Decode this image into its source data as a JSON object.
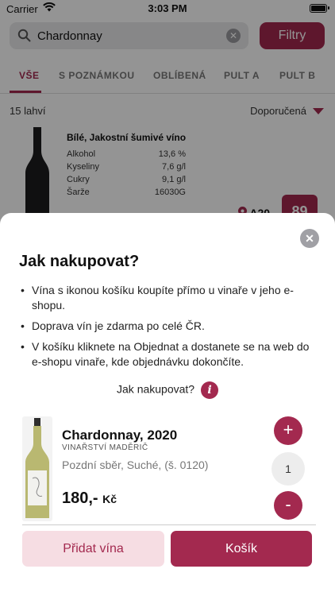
{
  "status": {
    "carrier": "Carrier",
    "time": "3:03 PM"
  },
  "search": {
    "value": "Chardonnay",
    "filter_label": "Filtry"
  },
  "tabs": [
    {
      "label": "VŠE",
      "active": true
    },
    {
      "label": "S POZNÁMKOU",
      "active": false
    },
    {
      "label": "OBLÍBENÁ",
      "active": false
    },
    {
      "label": "PULT A",
      "active": false
    },
    {
      "label": "PULT B",
      "active": false
    }
  ],
  "list": {
    "count": "15 lahví",
    "sort": "Doporučená"
  },
  "card": {
    "title": "Bílé, Jakostní šumivé víno",
    "rows": [
      {
        "label": "Alkohol",
        "value": "13,6 %"
      },
      {
        "label": "Kyseliny",
        "value": "7,6 g/l"
      },
      {
        "label": "Cukry",
        "value": "9,1 g/l"
      },
      {
        "label": "Šarže",
        "value": "16030G"
      }
    ],
    "location": "A20",
    "score": "89"
  },
  "modal": {
    "title": "Jak nakupovat?",
    "bullets": [
      "Vína s ikonou košíku koupíte přímo u vinaře v jeho e-shopu.",
      "Doprava vín je zdarma po celé ČR.",
      "V košíku kliknete na Objednat a dostanete se na web do e-shopu vinaře, kde objednávku dokončíte."
    ],
    "howto_label": "Jak nakupovat?",
    "info_glyph": "i",
    "product": {
      "name": "Chardonnay, 2020",
      "maker": "VINAŘSTVÍ MADĚRIČ",
      "description": "Pozdní sběr, Suché, (š. 0120)",
      "price": "180,-",
      "currency": "Kč",
      "quantity": "1"
    },
    "add_wines_label": "Přidat vína",
    "cart_label": "Košík"
  },
  "colors": {
    "accent": "#a3294f",
    "accent_light": "#f6dde3"
  }
}
